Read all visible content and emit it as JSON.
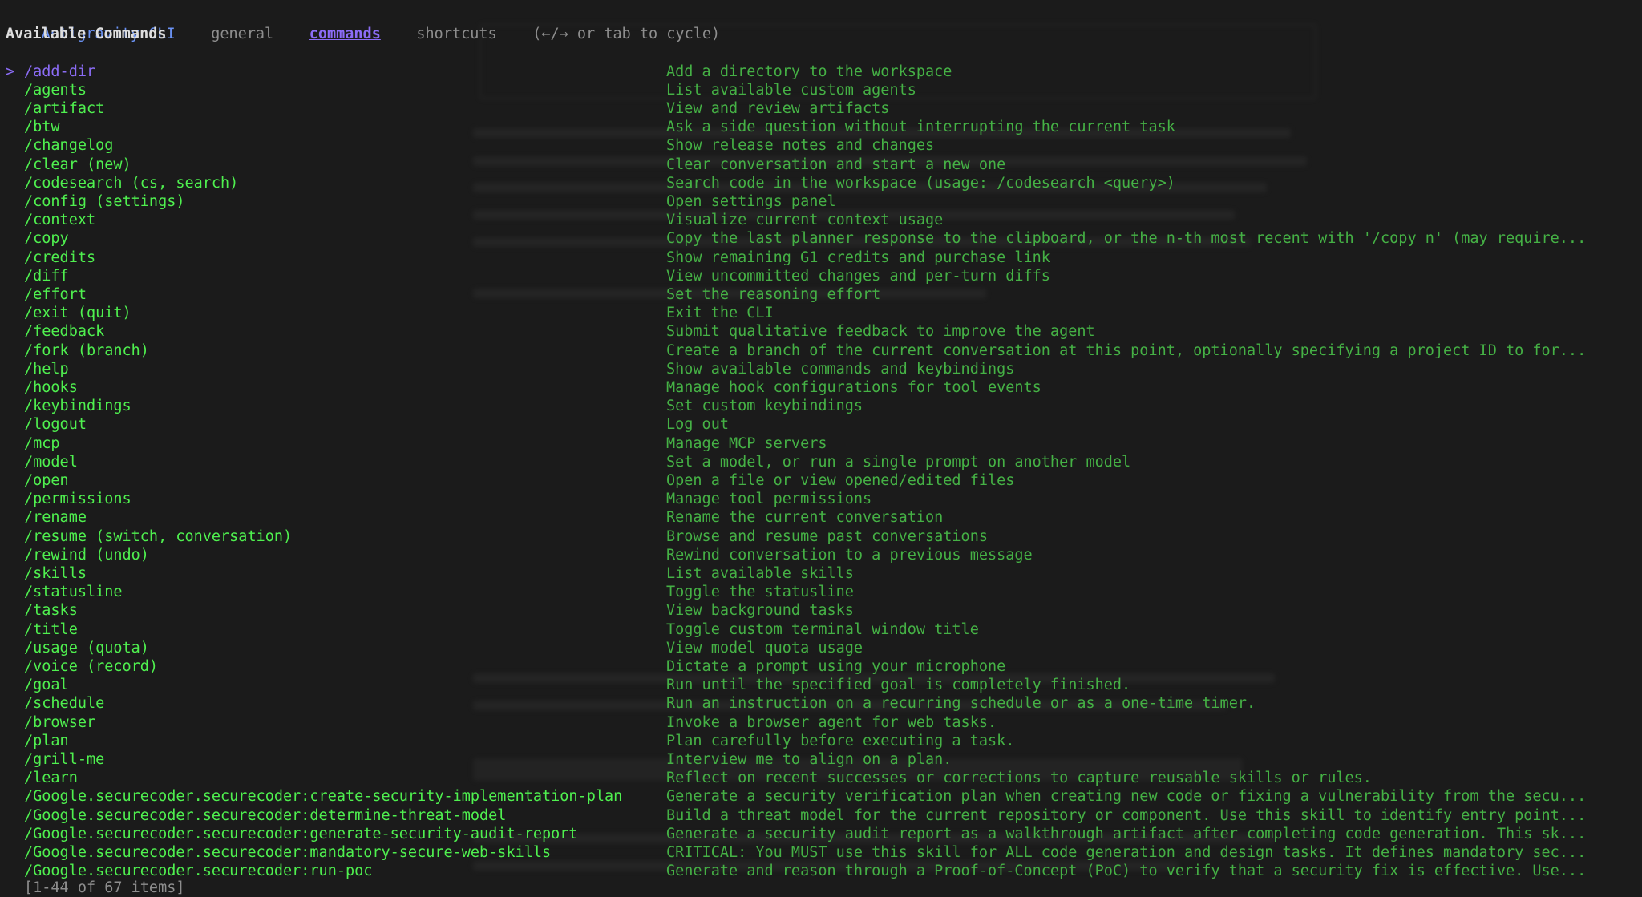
{
  "header": {
    "app_title": "Antigravity CLI",
    "tabs": [
      {
        "label": "general",
        "active": false
      },
      {
        "label": "commands",
        "active": true
      },
      {
        "label": "shortcuts",
        "active": false
      }
    ],
    "cycle_hint": "(←/→ or tab to cycle)"
  },
  "section_title": "Available Commands",
  "cursor_glyph": ">",
  "selected_index": 0,
  "commands": [
    {
      "name": "/add-dir",
      "desc": "Add a directory to the workspace"
    },
    {
      "name": "/agents",
      "desc": "List available custom agents"
    },
    {
      "name": "/artifact",
      "desc": "View and review artifacts"
    },
    {
      "name": "/btw",
      "desc": "Ask a side question without interrupting the current task"
    },
    {
      "name": "/changelog",
      "desc": "Show release notes and changes"
    },
    {
      "name": "/clear (new)",
      "desc": "Clear conversation and start a new one"
    },
    {
      "name": "/codesearch (cs, search)",
      "desc": "Search code in the workspace (usage: /codesearch <query>)"
    },
    {
      "name": "/config (settings)",
      "desc": "Open settings panel"
    },
    {
      "name": "/context",
      "desc": "Visualize current context usage"
    },
    {
      "name": "/copy",
      "desc": "Copy the last planner response to the clipboard, or the n-th most recent with '/copy n' (may require..."
    },
    {
      "name": "/credits",
      "desc": "Show remaining G1 credits and purchase link"
    },
    {
      "name": "/diff",
      "desc": "View uncommitted changes and per-turn diffs"
    },
    {
      "name": "/effort",
      "desc": "Set the reasoning effort"
    },
    {
      "name": "/exit (quit)",
      "desc": "Exit the CLI"
    },
    {
      "name": "/feedback",
      "desc": "Submit qualitative feedback to improve the agent"
    },
    {
      "name": "/fork (branch)",
      "desc": "Create a branch of the current conversation at this point, optionally specifying a project ID to for..."
    },
    {
      "name": "/help",
      "desc": "Show available commands and keybindings"
    },
    {
      "name": "/hooks",
      "desc": "Manage hook configurations for tool events"
    },
    {
      "name": "/keybindings",
      "desc": "Set custom keybindings"
    },
    {
      "name": "/logout",
      "desc": "Log out"
    },
    {
      "name": "/mcp",
      "desc": "Manage MCP servers"
    },
    {
      "name": "/model",
      "desc": "Set a model, or run a single prompt on another model"
    },
    {
      "name": "/open",
      "desc": "Open a file or view opened/edited files"
    },
    {
      "name": "/permissions",
      "desc": "Manage tool permissions"
    },
    {
      "name": "/rename",
      "desc": "Rename the current conversation"
    },
    {
      "name": "/resume (switch, conversation)",
      "desc": "Browse and resume past conversations"
    },
    {
      "name": "/rewind (undo)",
      "desc": "Rewind conversation to a previous message"
    },
    {
      "name": "/skills",
      "desc": "List available skills"
    },
    {
      "name": "/statusline",
      "desc": "Toggle the statusline"
    },
    {
      "name": "/tasks",
      "desc": "View background tasks"
    },
    {
      "name": "/title",
      "desc": "Toggle custom terminal window title"
    },
    {
      "name": "/usage (quota)",
      "desc": "View model quota usage"
    },
    {
      "name": "/voice (record)",
      "desc": "Dictate a prompt using your microphone"
    },
    {
      "name": "/goal",
      "desc": "Run until the specified goal is completely finished."
    },
    {
      "name": "/schedule",
      "desc": "Run an instruction on a recurring schedule or as a one-time timer."
    },
    {
      "name": "/browser",
      "desc": "Invoke a browser agent for web tasks."
    },
    {
      "name": "/plan",
      "desc": "Plan carefully before executing a task."
    },
    {
      "name": "/grill-me",
      "desc": "Interview me to align on a plan."
    },
    {
      "name": "/learn",
      "desc": "Reflect on recent successes or corrections to capture reusable skills or rules."
    },
    {
      "name": "/Google.securecoder.securecoder:create-security-implementation-plan",
      "desc": "Generate a security verification plan when creating new code or fixing a vulnerability from the secu..."
    },
    {
      "name": "/Google.securecoder.securecoder:determine-threat-model",
      "desc": "Build a threat model for the current repository or component. Use this skill to identify entry point..."
    },
    {
      "name": "/Google.securecoder.securecoder:generate-security-audit-report",
      "desc": "Generate a security audit report as a walkthrough artifact after completing code generation. This sk..."
    },
    {
      "name": "/Google.securecoder.securecoder:mandatory-secure-web-skills",
      "desc": "CRITICAL: You MUST use this skill for ALL code generation and design tasks. It defines mandatory sec..."
    },
    {
      "name": "/Google.securecoder.securecoder:run-poc",
      "desc": "Generate and reason through a Proof-of-Concept (PoC) to verify that a security fix is effective. Use..."
    }
  ],
  "footer": "[1-44 of 67 items]",
  "colors": {
    "background": "#1b1b1b",
    "command_name": "#4ff04f",
    "command_desc": "#45b145",
    "accent_purple": "#8b6cf5",
    "title_blue": "#6b93f5",
    "muted": "#8e8e8e"
  }
}
